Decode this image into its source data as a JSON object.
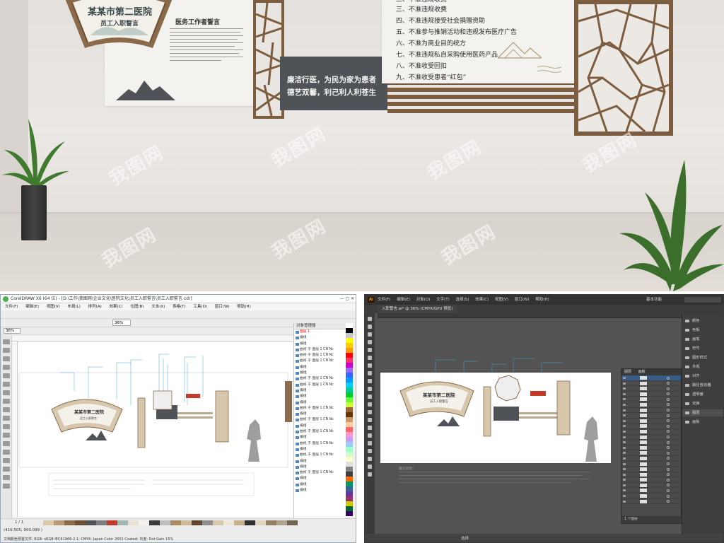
{
  "render": {
    "fan_title": "某某市第二医院",
    "fan_subtitle": "员工入职誓言",
    "oath_title": "医务工作者誓言",
    "slogan_line1": "廉洁行医，为民为家为患者",
    "slogan_line2": "德艺双馨，利己利人利苍生",
    "rules": [
      "三、不准违规收费",
      "四、不准违规接受社会捐赠资助",
      "五、不准参与推销活动和违规发布医疗广告",
      "六、不准为商业目的统方",
      "七、不准违规私自采购使用医药产品",
      "八、不准收受回扣",
      "九、不准收受患者“红包”"
    ],
    "rule_partial_top": "二、不准违规收费",
    "watermark": "我图网"
  },
  "coreldraw": {
    "title": "CorelDRAW X6 (64 位) - [D:\\工作\\我图网\\企业文化\\医院文化\\员工入职誓言\\员工入职誓言.cdr]",
    "window_buttons": "— ▢ ✕",
    "menu": [
      "文件(F)",
      "编辑(E)",
      "视图(V)",
      "布局(L)",
      "排列(A)",
      "效果(C)",
      "位图(B)",
      "文本(X)",
      "表格(T)",
      "工具(O)",
      "窗口(W)",
      "帮助(H)"
    ],
    "zoom_top": "36%",
    "zoom_left": "36%",
    "docker_title": "对象管理器",
    "layers": [
      {
        "label": "图层 1",
        "red": true
      },
      {
        "label": "编组",
        "red": false
      },
      {
        "label": "编组",
        "red": false
      },
      {
        "label": "曲线 于 图层 1 CN Nc",
        "red": false
      },
      {
        "label": "曲线 于 图层 1 CN Nc",
        "red": false
      },
      {
        "label": "曲线 于 图层 1 CN Nc",
        "red": false
      },
      {
        "label": "编组",
        "red": false
      },
      {
        "label": "编组",
        "red": false
      },
      {
        "label": "曲线 于 图层 1 CN Nc",
        "red": false
      },
      {
        "label": "曲线 于 图层 1 CN Nc",
        "red": false
      },
      {
        "label": "编组",
        "red": false
      },
      {
        "label": "编组",
        "red": false
      },
      {
        "label": "编组",
        "red": false
      },
      {
        "label": "曲线 于 图层 1 CN Nc",
        "red": false
      },
      {
        "label": "编组",
        "red": false
      },
      {
        "label": "曲线 于 图层 1 CN Nc",
        "red": false
      },
      {
        "label": "编组",
        "red": false
      },
      {
        "label": "曲线 于 图层 1 CN Nc",
        "red": false
      },
      {
        "label": "编组",
        "red": false
      },
      {
        "label": "曲线 于 图层 1 CN Nc",
        "red": false
      },
      {
        "label": "编组",
        "red": false
      },
      {
        "label": "曲线 于 图层 1 CN Nc",
        "red": false
      },
      {
        "label": "编组",
        "red": false
      },
      {
        "label": "编组",
        "red": false
      },
      {
        "label": "曲线 于 图层 1 CN Nc",
        "red": false
      },
      {
        "label": "编组",
        "red": false
      },
      {
        "label": "编组",
        "red": false
      },
      {
        "label": "编组",
        "red": false
      }
    ],
    "page_nav": "1 / 1",
    "coords": "(416.505, 900.099 )",
    "status": "文档颜色预置文件: RGB: sRGB IEC61966-2.1; CMYK: Japan Color 2001 Coated; 灰度: Dot Gain 15%"
  },
  "illustrator": {
    "logo": "Ai",
    "menu": [
      "文件(F)",
      "编辑(E)",
      "对象(O)",
      "文字(T)",
      "选择(S)",
      "效果(C)",
      "视图(V)",
      "窗口(W)",
      "帮助(H)"
    ],
    "workspace": "基本功能",
    "doc_tab": "入职誓言.ai* @ 36% (CMYK/GPU 预览)",
    "layers_panel_tabs": [
      "图层",
      "画板"
    ],
    "layer_rows": 24,
    "layers_footer": "1 个图层",
    "right_panel": [
      "颜色",
      "色板",
      "画笔",
      "符号",
      "图形样式",
      "外观",
      "对齐",
      "路径查找器",
      "透明度",
      "变换",
      "图层",
      "画板"
    ],
    "status": "选择",
    "canvas_title": "某某市第二医院",
    "canvas_sub": "员工入职誓言",
    "notes_label": "备注说明："
  },
  "colors": {
    "wood": "#8a6a4a",
    "slab": "#4f5256",
    "accent_red": "#c23a2a"
  }
}
